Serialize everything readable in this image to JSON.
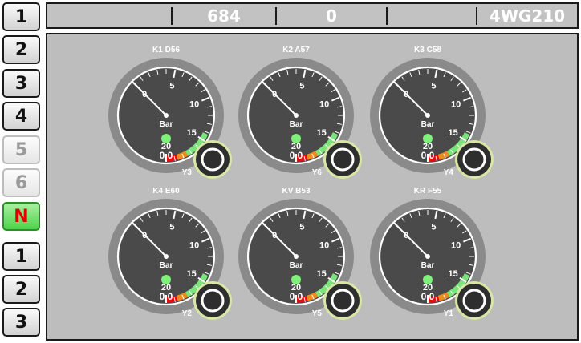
{
  "sidebar": {
    "buttons": [
      {
        "label": "1",
        "state": "normal"
      },
      {
        "label": "2",
        "state": "normal"
      },
      {
        "label": "3",
        "state": "normal"
      },
      {
        "label": "4",
        "state": "normal"
      },
      {
        "label": "5",
        "state": "disabled"
      },
      {
        "label": "6",
        "state": "disabled"
      },
      {
        "label": "N",
        "state": "active"
      },
      {
        "label": "1",
        "state": "normal"
      },
      {
        "label": "2",
        "state": "normal"
      },
      {
        "label": "3",
        "state": "normal"
      }
    ]
  },
  "header": {
    "cells": [
      "",
      "684",
      "0",
      "",
      "4WG210"
    ]
  },
  "gauges": [
    {
      "title": "K1 D56",
      "unit": "Bar",
      "value": 0.0,
      "display": "0.0",
      "valve": "Y3"
    },
    {
      "title": "K2 A57",
      "unit": "Bar",
      "value": 0.0,
      "display": "0.0",
      "valve": "Y6"
    },
    {
      "title": "K3 C58",
      "unit": "Bar",
      "value": 0.0,
      "display": "0.0",
      "valve": "Y4"
    },
    {
      "title": "K4 E60",
      "unit": "Bar",
      "value": 0.0,
      "display": "0.0",
      "valve": "Y2"
    },
    {
      "title": "KV B53",
      "unit": "Bar",
      "value": 0.0,
      "display": "0.0",
      "valve": "Y5"
    },
    {
      "title": "KR F55",
      "unit": "Bar",
      "value": 0.0,
      "display": "0.0",
      "valve": "Y1"
    }
  ],
  "scale": {
    "min": 0,
    "max": 20,
    "labels": [
      "0",
      "5",
      "10",
      "15",
      "20"
    ]
  },
  "colors": {
    "panel": "#bdbdbd",
    "header": "#c2c2c2",
    "dial_face": "#4a4a4a",
    "dial_ring": "#8a8a8a",
    "zone_green": "#7be37b",
    "zone_orange": "#f08a1c",
    "zone_red": "#e01010",
    "indicator": "#7ff07a",
    "active_button": "#4fd34a",
    "active_text": "#e00000"
  }
}
